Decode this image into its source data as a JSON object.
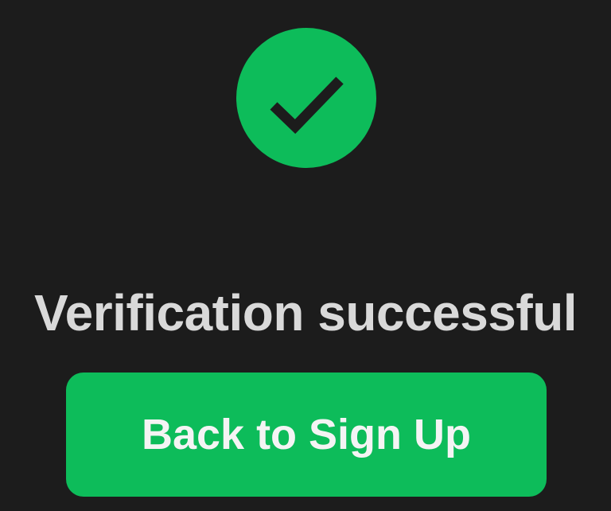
{
  "status": {
    "icon": "checkmark-icon",
    "accent_color": "#0dbc5a",
    "title": "Verification successful"
  },
  "actions": {
    "back_label": "Back to Sign Up"
  }
}
